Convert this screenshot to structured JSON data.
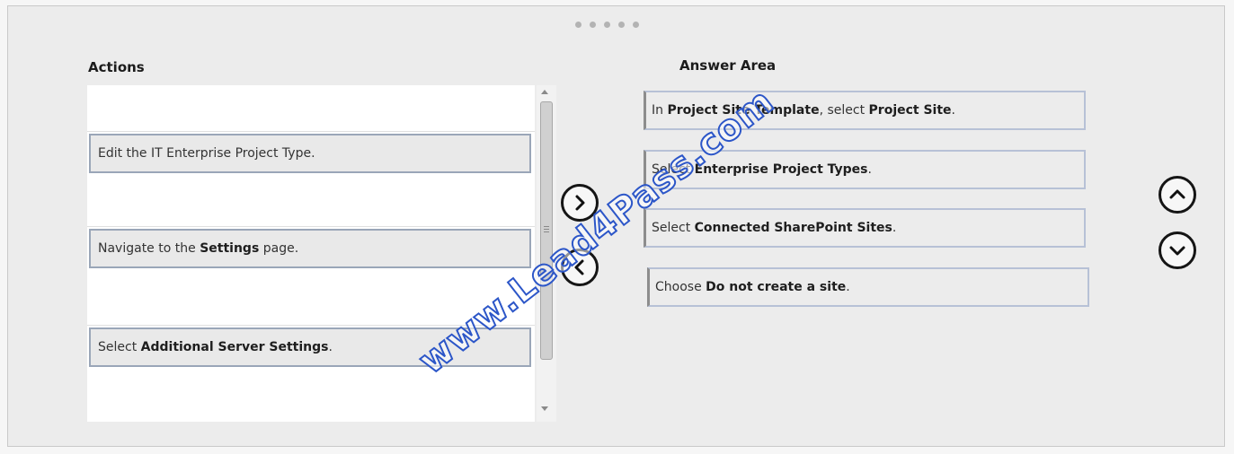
{
  "actions": {
    "heading": "Actions",
    "items": [
      {
        "prefix": "Edit the IT Enterprise Project Type.",
        "bold": "",
        "suffix": ""
      },
      {
        "prefix": "Navigate to the ",
        "bold": "Settings",
        "suffix": " page."
      },
      {
        "prefix": "Select ",
        "bold": "Additional Server Settings",
        "suffix": "."
      }
    ]
  },
  "answer": {
    "heading": "Answer Area",
    "items": [
      {
        "prefix": "In ",
        "bold": "Project Site Template",
        "middle": ", select ",
        "bold2": "Project Site",
        "suffix": "."
      },
      {
        "prefix": "Select ",
        "bold": "Enterprise Project Types",
        "middle": "",
        "bold2": "",
        "suffix": "."
      },
      {
        "prefix": "Select ",
        "bold": "Connected SharePoint Sites",
        "middle": "",
        "bold2": "",
        "suffix": "."
      },
      {
        "prefix": "Choose ",
        "bold": "Do not create a site",
        "middle": "",
        "bold2": "",
        "suffix": "."
      }
    ]
  },
  "watermark": "www.Lead4Pass.com",
  "icons": {
    "move_right": "chevron-right-icon",
    "move_left": "chevron-left-icon",
    "move_up": "chevron-up-icon",
    "move_down": "chevron-down-icon"
  },
  "colors": {
    "item_border": "#9aa6b8",
    "answer_border": "#b7c1d6",
    "watermark_stroke": "#2c56c8"
  }
}
